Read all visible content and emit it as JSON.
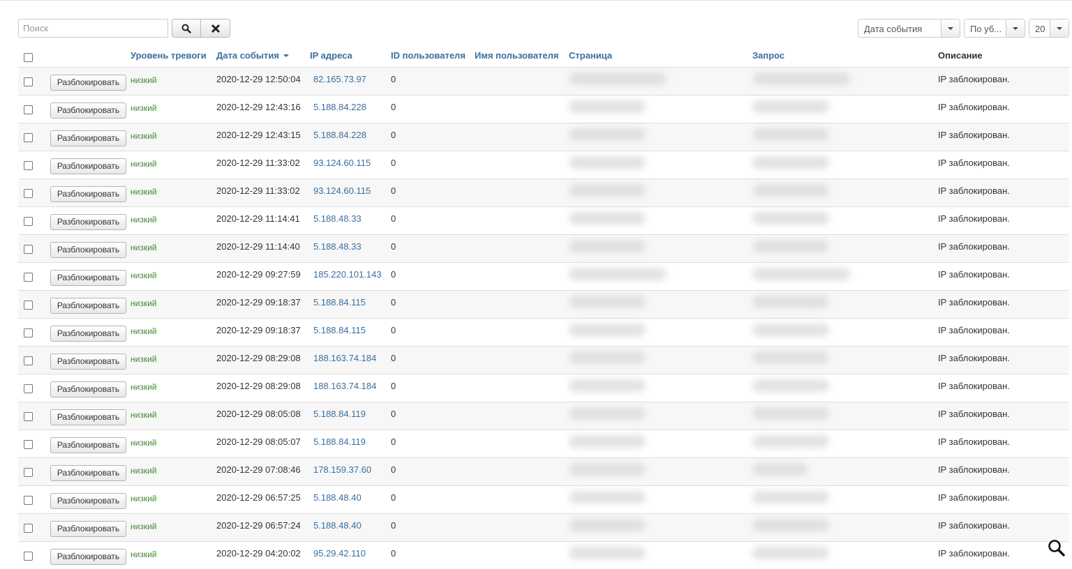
{
  "toolbar": {
    "search_placeholder": "Поиск",
    "sort_field": "Дата события",
    "sort_direction": "По уб...",
    "limit": "20"
  },
  "table": {
    "headers": {
      "alert_level": "Уровень тревоги",
      "event_date": "Дата события",
      "ip": "IP адреса",
      "user_id": "ID пользователя",
      "username": "Имя пользователя",
      "page": "Страница",
      "query": "Запрос",
      "description": "Описание"
    },
    "unblock_label": "Разблокировать",
    "rows": [
      {
        "level": "низкий",
        "date": "2020-12-29 12:50:04",
        "ip": "82.165.73.97",
        "user_id": "0",
        "description": "IP заблокирован."
      },
      {
        "level": "низкий",
        "date": "2020-12-29 12:43:16",
        "ip": "5.188.84.228",
        "user_id": "0",
        "description": "IP заблокирован."
      },
      {
        "level": "низкий",
        "date": "2020-12-29 12:43:15",
        "ip": "5.188.84.228",
        "user_id": "0",
        "description": "IP заблокирован."
      },
      {
        "level": "низкий",
        "date": "2020-12-29 11:33:02",
        "ip": "93.124.60.115",
        "user_id": "0",
        "description": "IP заблокирован."
      },
      {
        "level": "низкий",
        "date": "2020-12-29 11:33:02",
        "ip": "93.124.60.115",
        "user_id": "0",
        "description": "IP заблокирован."
      },
      {
        "level": "низкий",
        "date": "2020-12-29 11:14:41",
        "ip": "5.188.48.33",
        "user_id": "0",
        "description": "IP заблокирован."
      },
      {
        "level": "низкий",
        "date": "2020-12-29 11:14:40",
        "ip": "5.188.48.33",
        "user_id": "0",
        "description": "IP заблокирован."
      },
      {
        "level": "низкий",
        "date": "2020-12-29 09:27:59",
        "ip": "185.220.101.143",
        "user_id": "0",
        "description": "IP заблокирован."
      },
      {
        "level": "низкий",
        "date": "2020-12-29 09:18:37",
        "ip": "5.188.84.115",
        "user_id": "0",
        "description": "IP заблокирован."
      },
      {
        "level": "низкий",
        "date": "2020-12-29 09:18:37",
        "ip": "5.188.84.115",
        "user_id": "0",
        "description": "IP заблокирован."
      },
      {
        "level": "низкий",
        "date": "2020-12-29 08:29:08",
        "ip": "188.163.74.184",
        "user_id": "0",
        "description": "IP заблокирован."
      },
      {
        "level": "низкий",
        "date": "2020-12-29 08:29:08",
        "ip": "188.163.74.184",
        "user_id": "0",
        "description": "IP заблокирован."
      },
      {
        "level": "низкий",
        "date": "2020-12-29 08:05:08",
        "ip": "5.188.84.119",
        "user_id": "0",
        "description": "IP заблокирован."
      },
      {
        "level": "низкий",
        "date": "2020-12-29 08:05:07",
        "ip": "5.188.84.119",
        "user_id": "0",
        "description": "IP заблокирован."
      },
      {
        "level": "низкий",
        "date": "2020-12-29 07:08:46",
        "ip": "178.159.37.60",
        "user_id": "0",
        "description": "IP заблокирован."
      },
      {
        "level": "низкий",
        "date": "2020-12-29 06:57:25",
        "ip": "5.188.48.40",
        "user_id": "0",
        "description": "IP заблокирован."
      },
      {
        "level": "низкий",
        "date": "2020-12-29 06:57:24",
        "ip": "5.188.48.40",
        "user_id": "0",
        "description": "IP заблокирован."
      },
      {
        "level": "низкий",
        "date": "2020-12-29 04:20:02",
        "ip": "95.29.42.110",
        "user_id": "0",
        "description": "IP заблокирован."
      }
    ]
  },
  "icons": {
    "search": "search-icon",
    "clear": "close-icon",
    "caret": "caret-down-icon",
    "sort": "sort-desc-icon",
    "zoom": "zoom-icon"
  },
  "colors": {
    "link": "#3a6f9f",
    "level_low": "#3d8b2e",
    "row_stripe": "#f7f7f7"
  }
}
